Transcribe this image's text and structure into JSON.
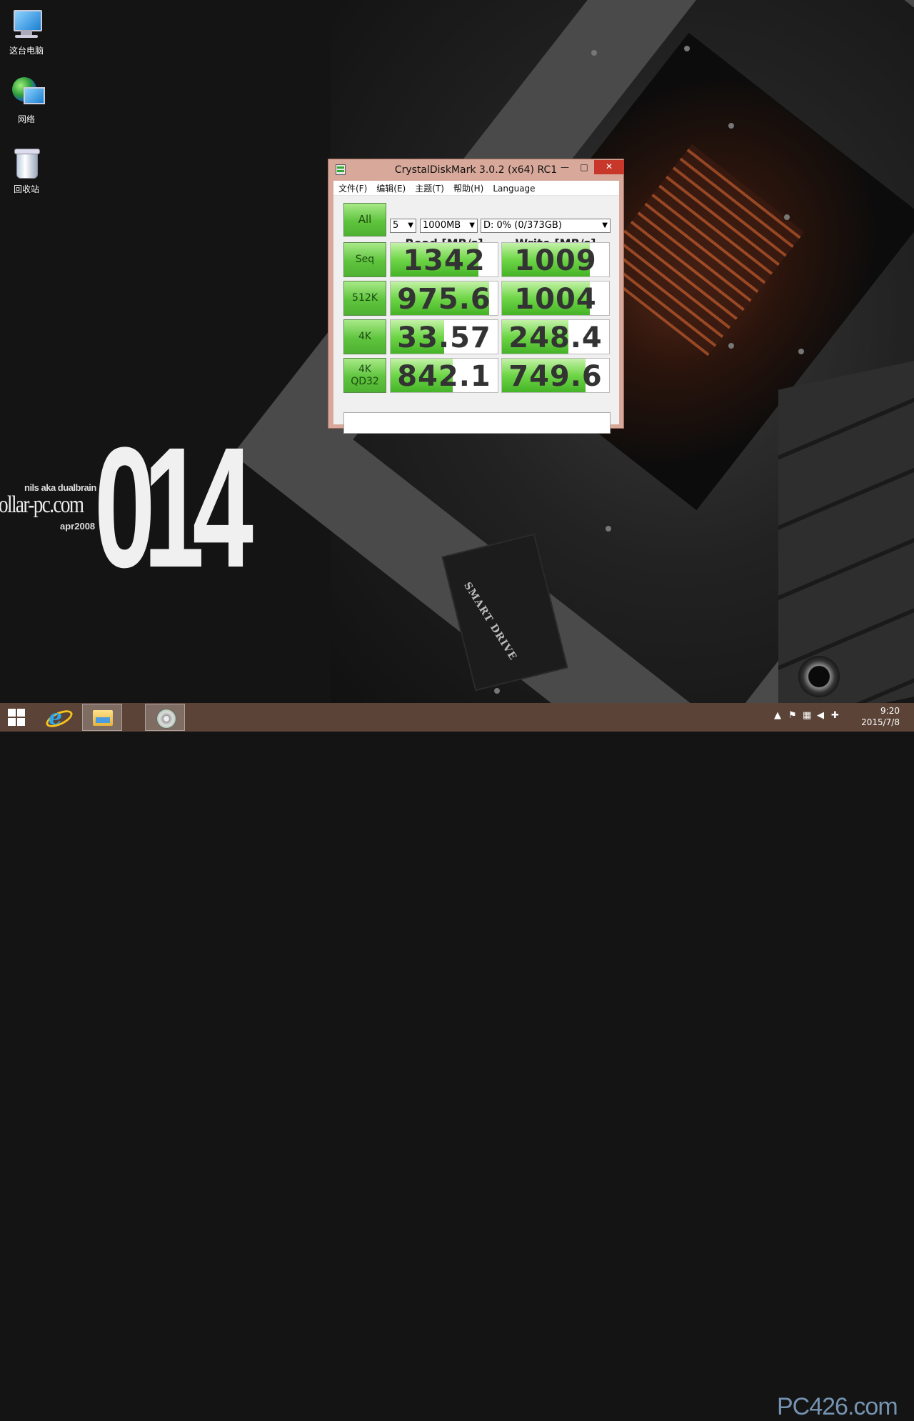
{
  "desktop": {
    "icons": [
      {
        "label": "这台电脑",
        "icon": "computer-icon"
      },
      {
        "label": "网络",
        "icon": "network-icon"
      },
      {
        "label": "回收站",
        "icon": "recycle-bin-icon"
      }
    ],
    "wallpaper": {
      "big_text": "014",
      "line1": "nils aka dualbrain",
      "line2": "ollar-pc.com",
      "line3": "apr2008",
      "drive_label": "SMART DRIVE"
    }
  },
  "window": {
    "title": "CrystalDiskMark 3.0.2 (x64) RC1",
    "controls": {
      "minimize": "—",
      "maximize": "□",
      "close": "✕"
    },
    "menu": [
      "文件(F)",
      "编辑(E)",
      "主题(T)",
      "帮助(H)",
      "Language"
    ],
    "all_button": "All",
    "options": {
      "count": "5",
      "size": "1000MB",
      "drive": "D: 0% (0/373GB)"
    },
    "headers": {
      "read": "Read [MB/s]",
      "write": "Write [MB/s]"
    },
    "rows": [
      {
        "label": "Seq",
        "label2": "",
        "read": "1342",
        "write": "1009",
        "read_fill": 0.82,
        "write_fill": 0.82
      },
      {
        "label": "512K",
        "label2": "",
        "read": "975.6",
        "write": "1004",
        "read_fill": 0.92,
        "write_fill": 0.82
      },
      {
        "label": "4K",
        "label2": "",
        "read": "33.57",
        "write": "248.4",
        "read_fill": 0.5,
        "write_fill": 0.62
      },
      {
        "label": "4K",
        "label2": "QD32",
        "read": "842.1",
        "write": "749.6",
        "read_fill": 0.58,
        "write_fill": 0.78
      }
    ],
    "status_text": ""
  },
  "taskbar": {
    "apps": [
      {
        "name": "internet-explorer",
        "icon": "ie-icon"
      },
      {
        "name": "file-explorer",
        "icon": "folder-icon"
      },
      {
        "name": "crystaldiskmark",
        "icon": "disk-icon"
      }
    ],
    "clock_time": "9:20",
    "clock_date": "2015/7/8",
    "watermark": "PC426.com"
  },
  "colors": {
    "accent_green": "#5fc43e",
    "window_border": "#d8a99a",
    "close_red": "#c7372a",
    "taskbar": "#5f463a"
  }
}
